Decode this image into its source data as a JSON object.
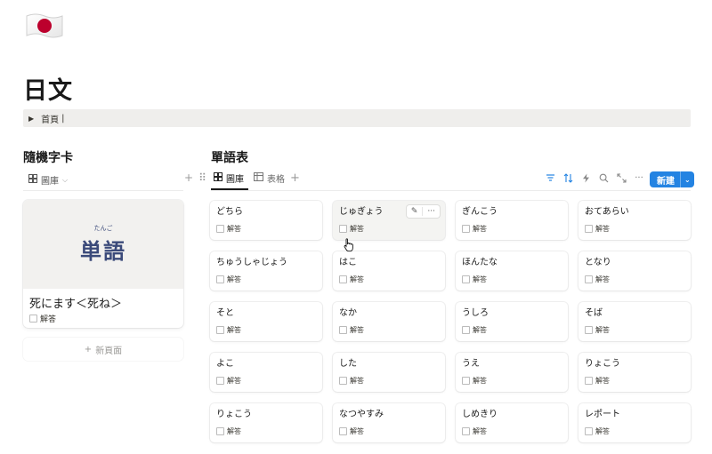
{
  "page": {
    "title": "日文",
    "breadcrumb": "首頁",
    "breadcrumb_caret": "|"
  },
  "left": {
    "title": "隨機字卡",
    "view_label": "圖庫",
    "card": {
      "ruby": "たんご",
      "kanji": "単語",
      "title": "死にます＜死ね＞",
      "check_label": "解答"
    },
    "new_page_label": "新頁面"
  },
  "right": {
    "title": "單語表",
    "tabs": [
      {
        "label": "圖庫",
        "icon": "gallery-icon",
        "active": true
      },
      {
        "label": "表格",
        "icon": "table-icon",
        "active": false
      }
    ],
    "toolbar_icons": [
      "filter-icon",
      "sort-icon",
      "automation-icon",
      "search-icon",
      "expand-icon",
      "more-icon"
    ],
    "new_label": "新建",
    "check_label": "解答",
    "cards": [
      {
        "word": "どちら"
      },
      {
        "word": "じゅぎょう"
      },
      {
        "word": "ぎんこう"
      },
      {
        "word": "おてあらい"
      },
      {
        "word": "ちゅうしゃじょう"
      },
      {
        "word": "はこ"
      },
      {
        "word": "ほんたな"
      },
      {
        "word": "となり"
      },
      {
        "word": "そと"
      },
      {
        "word": "なか"
      },
      {
        "word": "うしろ"
      },
      {
        "word": "そば"
      },
      {
        "word": "よこ"
      },
      {
        "word": "した"
      },
      {
        "word": "うえ"
      },
      {
        "word": "りょこう"
      },
      {
        "word": "りょこう"
      },
      {
        "word": "なつやすみ"
      },
      {
        "word": "しめきり"
      },
      {
        "word": "レポート"
      }
    ]
  },
  "colors": {
    "accent": "#2383e2",
    "kanji": "#3b4a7a",
    "flag_red": "#bc002d"
  }
}
